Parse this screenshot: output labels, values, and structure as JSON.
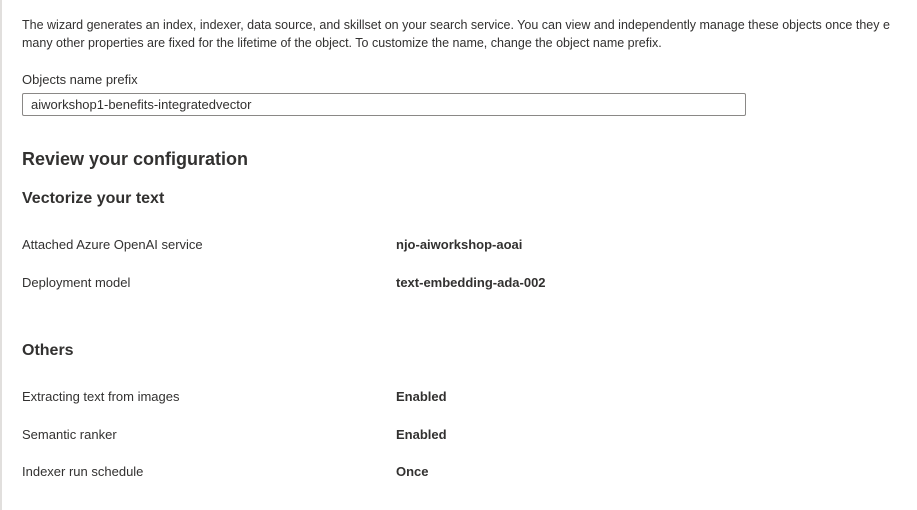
{
  "description": {
    "line1": "The wizard generates an index, indexer, data source, and skillset on your search service. You can view and independently manage these objects once they e",
    "line2": "many other properties are fixed for the lifetime of the object. To customize the name, change the object name prefix."
  },
  "objects_prefix": {
    "label": "Objects name prefix",
    "value": "aiworkshop1-benefits-integratedvector"
  },
  "review": {
    "heading": "Review your configuration",
    "vectorize": {
      "heading": "Vectorize your text",
      "rows": [
        {
          "label": "Attached Azure OpenAI service",
          "value": "njo-aiworkshop-aoai"
        },
        {
          "label": "Deployment model",
          "value": "text-embedding-ada-002"
        }
      ]
    },
    "others": {
      "heading": "Others",
      "rows": [
        {
          "label": "Extracting text from images",
          "value": "Enabled"
        },
        {
          "label": "Semantic ranker",
          "value": "Enabled"
        },
        {
          "label": "Indexer run schedule",
          "value": "Once"
        }
      ]
    }
  }
}
